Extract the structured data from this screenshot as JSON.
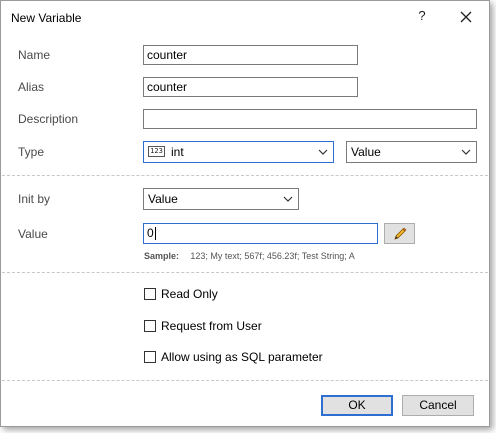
{
  "dialog": {
    "title": "New Variable",
    "help_glyph": "?"
  },
  "fields": {
    "name": {
      "label": "Name",
      "value": "counter"
    },
    "alias": {
      "label": "Alias",
      "value": "counter"
    },
    "description": {
      "label": "Description",
      "value": ""
    },
    "type": {
      "label": "Type",
      "selected": "int",
      "icon_text": "123",
      "kind_selected": "Value"
    },
    "init_by": {
      "label": "Init by",
      "selected": "Value"
    },
    "value": {
      "label": "Value",
      "value": "0"
    }
  },
  "sample": {
    "label": "Sample:",
    "text": "123; My text; 567f; 456.23f; Test String; A"
  },
  "checkboxes": {
    "read_only": {
      "label": "Read Only",
      "checked": false
    },
    "request_from_user": {
      "label": "Request from User",
      "checked": false
    },
    "allow_sql_param": {
      "label": "Allow using as SQL parameter",
      "checked": false
    }
  },
  "buttons": {
    "ok": "OK",
    "cancel": "Cancel"
  },
  "colors": {
    "focus_border": "#2f6fd1",
    "button_bg": "#e1e1e1",
    "separator": "#c8c8c8"
  },
  "icons": {
    "close": "close-icon",
    "pencil": "pencil-icon",
    "type": "numeric-type-icon",
    "dropdown": "chevron-down-icon"
  }
}
